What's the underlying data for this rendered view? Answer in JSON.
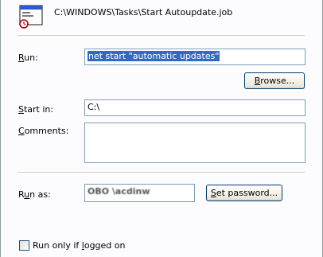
{
  "header": {
    "job_path": "C:\\WINDOWS\\Tasks\\Start Autoupdate.job",
    "job_icon": "scheduled-task-icon"
  },
  "run": {
    "label_pre": "",
    "label_key": "R",
    "label_post": "un:",
    "value": "net start \"automatic updates\""
  },
  "browse": {
    "label_key": "B",
    "label_post": "rowse..."
  },
  "start_in": {
    "label_pre": "",
    "label_key": "S",
    "label_post": "tart in:",
    "value": "C:\\"
  },
  "comments": {
    "label_pre": "",
    "label_key": "C",
    "label_post": "omments:",
    "value": ""
  },
  "run_as": {
    "label_pre": "R",
    "label_key": "u",
    "label_post": "n as:",
    "value": "OBO \\acdinw"
  },
  "set_password": {
    "label_key": "S",
    "label_post": "et password..."
  },
  "run_only": {
    "label_pre": "Run only if ",
    "label_key": "l",
    "label_post": "ogged on",
    "checked": false
  }
}
